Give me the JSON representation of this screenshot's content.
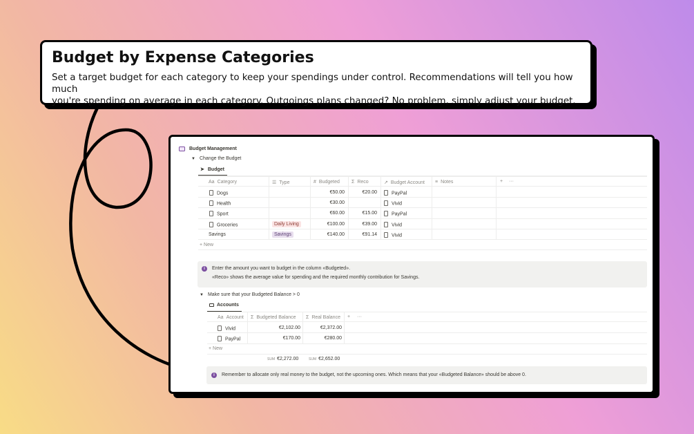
{
  "callout": {
    "title": "Budget by Expense Categories",
    "line1": "Set a target budget for each category to keep your spendings under control. Recommendations will tell you how much",
    "line2": "you're spending on average in each category. Outgoings plans changed? No problem, simply adjust your budget."
  },
  "page": {
    "title": "Budget Management",
    "toggle1": "Change the Budget",
    "toggle2": "Make sure that your Budgeted Balance > 0"
  },
  "budget": {
    "tab": "Budget",
    "headers": {
      "category": "Category",
      "type": "Type",
      "budgeted": "Budgeted",
      "reco": "Reco",
      "account": "Budget Account",
      "notes": "Notes",
      "add": "+",
      "more": "···"
    },
    "rows": [
      {
        "category": "Dogs",
        "type": "",
        "budgeted": "€50.00",
        "reco": "€20.00",
        "account": "PayPal"
      },
      {
        "category": "Health",
        "type": "",
        "budgeted": "€30.00",
        "reco": "",
        "account": "Vivid"
      },
      {
        "category": "Sport",
        "type": "",
        "budgeted": "€60.00",
        "reco": "€15.00",
        "account": "PayPal"
      },
      {
        "category": "Groceries",
        "type": "Daily Living",
        "budgeted": "€100.00",
        "reco": "€39.00",
        "account": "Vivid"
      },
      {
        "category": "Savings",
        "type": "Savings",
        "budgeted": "€140.00",
        "reco": "€91.14",
        "account": "Vivid"
      }
    ],
    "new_label": "+ New"
  },
  "info1": {
    "line1": "Enter the amount you want to budget in the column «Budgeted».",
    "line2": "«Reco» shows the average value for spending and the required monthly contribution for Savings."
  },
  "accounts": {
    "tab": "Accounts",
    "headers": {
      "account": "Account",
      "budgeted_balance": "Budgeted Balance",
      "real_balance": "Real Balance",
      "add": "+",
      "more": "···"
    },
    "rows": [
      {
        "account": "Vivid",
        "budgeted_balance": "€2,102.00",
        "real_balance": "€2,372.00"
      },
      {
        "account": "PayPal",
        "budgeted_balance": "€170.00",
        "real_balance": "€280.00"
      }
    ],
    "new_label": "+ New",
    "sum_label": "SUM",
    "sum_budgeted": "€2,272.00",
    "sum_real": "€2,652.00"
  },
  "info2": {
    "text": "Remember to allocate only real money to the budget, not the upcoming ones. Which means that your «Budgeted Balance» should be above 0."
  },
  "icons": {
    "text_icon": "Aa",
    "list_icon": "☰",
    "number_icon": "#",
    "sigma_icon": "Σ",
    "relation_icon": "↗",
    "notes_icon": "≡"
  },
  "colors": {
    "accent": "#7c4fa0",
    "info_bg": "#f1f1ef"
  }
}
